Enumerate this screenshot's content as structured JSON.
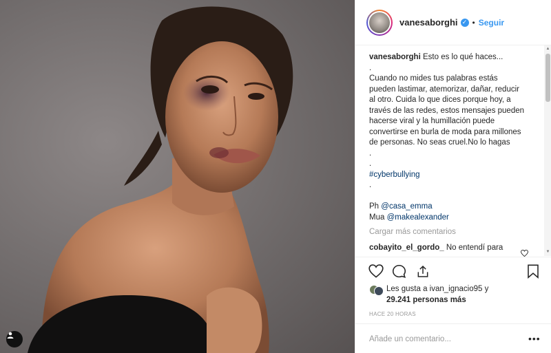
{
  "post": {
    "username": "vanesaborghi",
    "follow_label": "Seguir",
    "dot_separator": "•",
    "caption_lines": [
      "Esto es lo qué haces...",
      ".",
      "Cuando no mides tus palabras estás",
      "pueden lastimar, atemorizar, dañar, reducir",
      "al otro. Cuida lo que dices porque hoy, a",
      "través de las redes, estos mensajes pueden",
      "hacerse viral y la humillación puede",
      "convertirse en burla de moda para millones",
      "de personas. No seas cruel.No lo hagas",
      ".",
      ".",
      "#cyberbullying",
      ".",
      "",
      "Ph",
      "@casa_emma",
      "Mua",
      "@makealexander"
    ],
    "load_more": "Cargar más comentarios",
    "comment": {
      "username": "cobayito_el_gordo_",
      "text": "No entendí para"
    },
    "likes": {
      "prefix": "Les gusta a",
      "first_user": "ivan_ignacio95",
      "joiner": "y",
      "count_text": "29.241 personas más"
    },
    "time_ago": "HACE 20 HORAS",
    "add_comment_placeholder": "Añade un comentario...",
    "more_label": "•••"
  },
  "icons": {
    "like": "heart-icon",
    "comment": "comment-bubble-icon",
    "share": "share-icon",
    "save": "bookmark-icon",
    "tags": "user-tag-icon",
    "verified": "verified-badge-icon"
  },
  "colors": {
    "link": "#003569",
    "accent": "#3897f0",
    "muted": "#999999",
    "border": "#efefef"
  }
}
